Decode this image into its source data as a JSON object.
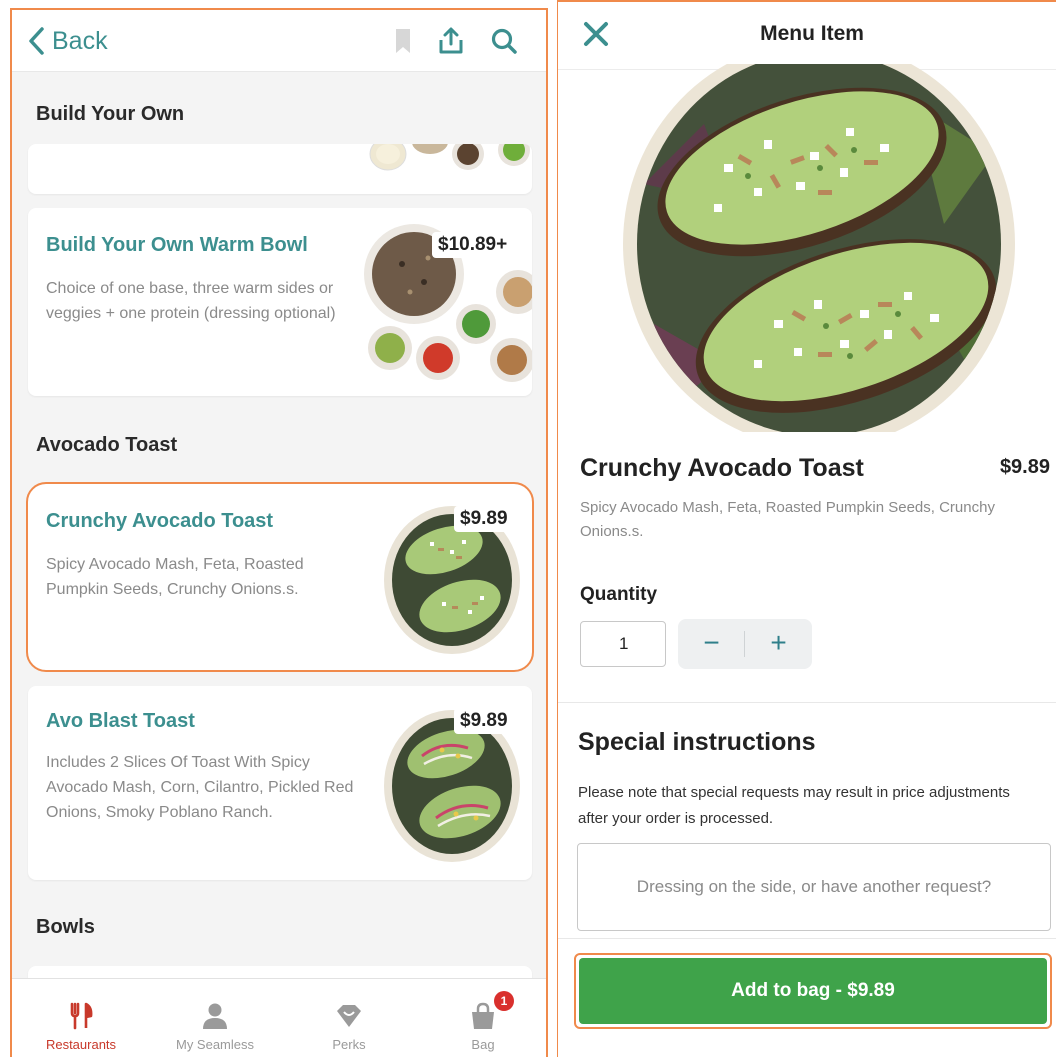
{
  "left": {
    "header": {
      "back_label": "Back"
    },
    "sections": [
      {
        "title": "Build Your Own"
      },
      {
        "title": "Avocado Toast"
      },
      {
        "title": "Bowls"
      }
    ],
    "items": [
      {
        "name": "Build Your Own Warm Bowl",
        "description": "Choice of one base, three warm sides or veggies + one protein (dressing optional)",
        "price": "$10.89+"
      },
      {
        "name": "Crunchy Avocado Toast",
        "description": "Spicy Avocado Mash, Feta, Roasted Pumpkin Seeds, Crunchy Onions.s.",
        "price": "$9.89"
      },
      {
        "name": "Avo Blast Toast",
        "description": "Includes 2 Slices Of Toast With Spicy Avocado Mash, Corn, Cilantro, Pickled Red Onions, Smoky Poblano Ranch.",
        "price": "$9.89"
      }
    ],
    "tabbar": {
      "tabs": [
        {
          "label": "Restaurants"
        },
        {
          "label": "My Seamless"
        },
        {
          "label": "Perks"
        },
        {
          "label": "Bag"
        }
      ],
      "bag_count": "1"
    }
  },
  "right": {
    "header": {
      "title": "Menu Item"
    },
    "item": {
      "name": "Crunchy Avocado Toast",
      "price": "$9.89",
      "description": "Spicy Avocado Mash, Feta, Roasted Pumpkin Seeds, Crunchy Onions.s."
    },
    "quantity": {
      "label": "Quantity",
      "value": "1",
      "minus": "−",
      "plus": "+"
    },
    "special": {
      "title": "Special instructions",
      "note": "Please note that special requests may result in price adjustments after your order is processed.",
      "placeholder": "Dressing on the side, or have another request?"
    },
    "add_button": "Add to bag - $9.89"
  },
  "colors": {
    "teal": "#3c8f8f",
    "highlight_orange": "#f08a4b",
    "active_tab_red": "#c8392b",
    "add_button_green": "#3fa34a",
    "badge_red": "#d9302d"
  },
  "icons": [
    "chevron-left-icon",
    "bookmark-icon",
    "share-icon",
    "search-icon",
    "fork-knife-icon",
    "person-icon",
    "diamond-icon",
    "bag-icon",
    "close-icon"
  ]
}
